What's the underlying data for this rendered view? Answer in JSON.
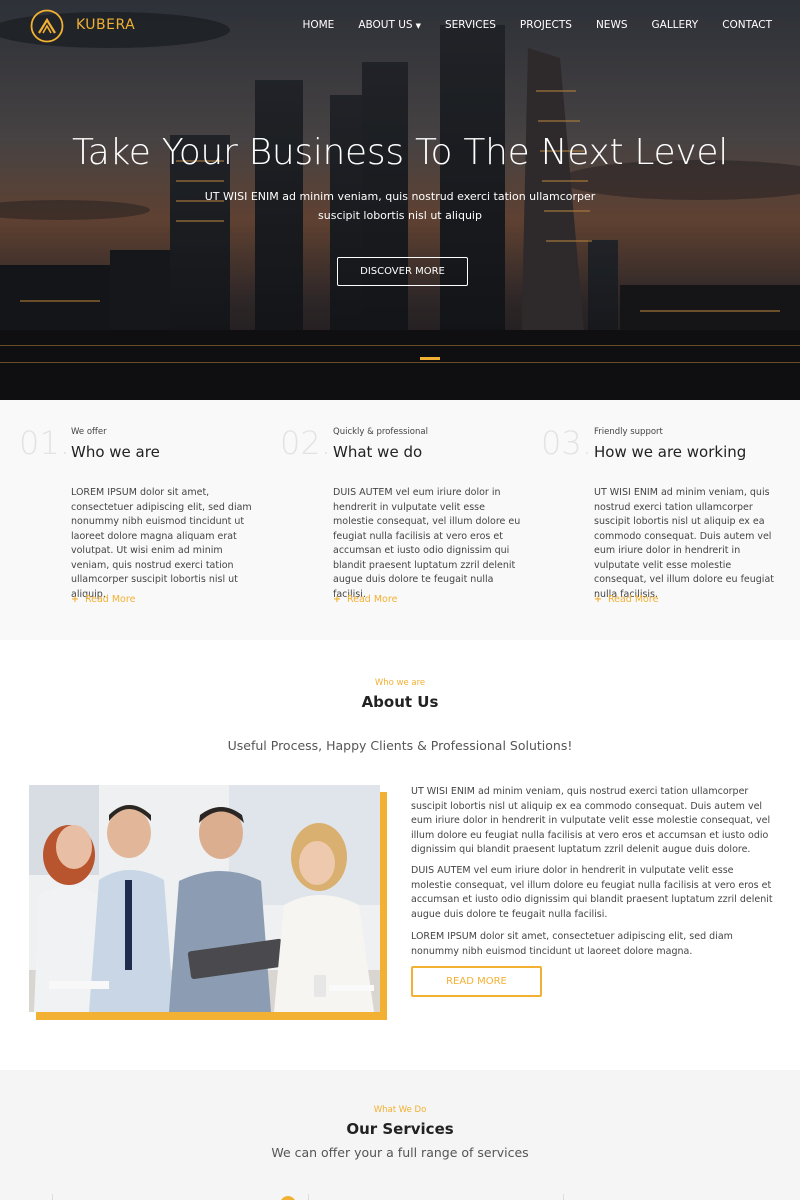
{
  "header": {
    "brand": "KUBERA",
    "nav": [
      {
        "label": "HOME"
      },
      {
        "label": "ABOUT US",
        "has_dropdown": true
      },
      {
        "label": "SERVICES"
      },
      {
        "label": "PROJECTS"
      },
      {
        "label": "NEWS"
      },
      {
        "label": "GALLERY"
      },
      {
        "label": "CONTACT"
      }
    ]
  },
  "hero": {
    "title": "Take Your Business To The Next Level",
    "subtitle": "UT WISI ENIM ad minim veniam, quis nostrud exerci tation ullamcorper suscipit lobortis nisl ut aliquip",
    "button": "DISCOVER MORE"
  },
  "features": [
    {
      "number": "01.",
      "kicker": "We offer",
      "title": "Who we are",
      "text": "LOREM IPSUM dolor sit amet, consectetuer adipiscing elit, sed diam nonummy nibh euismod tincidunt ut laoreet dolore magna aliquam erat volutpat. Ut wisi enim ad minim veniam, quis nostrud exerci tation ullamcorper suscipit lobortis nisl ut aliquip.",
      "link": "Read More"
    },
    {
      "number": "02.",
      "kicker": "Quickly & professional",
      "title": "What we do",
      "text": "DUIS AUTEM vel eum iriure dolor in hendrerit in vulputate velit esse molestie consequat, vel illum dolore eu feugiat nulla facilisis at vero eros et accumsan et iusto odio dignissim qui blandit praesent luptatum zzril delenit augue duis dolore te feugait nulla facilisi.",
      "link": "Read More"
    },
    {
      "number": "03.",
      "kicker": "Friendly support",
      "title": "How we are working",
      "text": "UT WISI ENIM ad minim veniam, quis nostrud exerci tation ullamcorper suscipit lobortis nisl ut aliquip ex ea commodo consequat. Duis autem vel eum iriure dolor in hendrerit in vulputate velit esse molestie consequat, vel illum dolore eu feugiat nulla facilisis.",
      "link": "Read More"
    }
  ],
  "about": {
    "kicker": "Who we are",
    "title": "About Us",
    "tagline": "Useful Process, Happy Clients & Professional Solutions!",
    "paragraphs": [
      "UT WISI ENIM ad minim veniam, quis nostrud exerci tation ullamcorper suscipit lobortis nisl ut aliquip ex ea commodo consequat. Duis autem vel eum iriure dolor in hendrerit in vulputate velit esse molestie consequat, vel illum dolore eu feugiat nulla facilisis at vero eros et accumsan et iusto odio dignissim qui blandit praesent luptatum zzril delenit augue duis dolore.",
      "DUIS AUTEM vel eum iriure dolor in hendrerit in vulputate velit esse molestie consequat, vel illum dolore eu feugiat nulla facilisis at vero eros et accumsan et iusto odio dignissim qui blandit praesent luptatum zzril delenit augue duis dolore te feugait nulla facilisi.",
      "LOREM IPSUM dolor sit amet, consectetuer adipiscing elit, sed diam nonummy nibh euismod tincidunt ut laoreet dolore magna."
    ],
    "button": "READ MORE"
  },
  "services": {
    "kicker": "What We Do",
    "title": "Our Services",
    "subtitle": "We can offer your a full range of services"
  },
  "colors": {
    "accent": "#f2b133",
    "dark_text": "#222222",
    "body_text": "#444444",
    "section_bg": "#f9f9f9"
  },
  "icons": {
    "logo": "kubera-roof-logo",
    "read_more": "plus-icon",
    "dropdown": "caret-down-icon"
  }
}
